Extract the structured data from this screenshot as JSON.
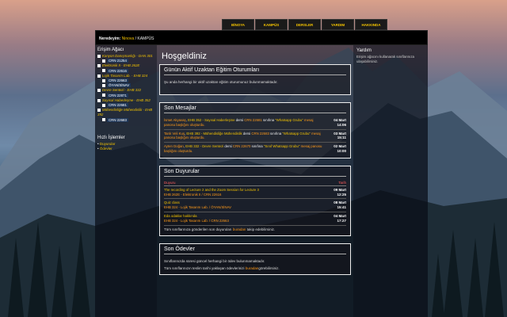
{
  "nav": {
    "tabs": [
      "BİNOYA",
      "KAMPÜS",
      "DERSLER",
      "YARDIM",
      "HAKKINDA"
    ]
  },
  "breadcrumb": {
    "label": "Neredeyim:",
    "home": "Ninova",
    "sep": " / ",
    "current": "KAMPÜS"
  },
  "left": {
    "tree_title": "Erişim Ağacı",
    "tree": [
      {
        "kind": "course",
        "text": "Kanyon Danışmanlığı - DAN 301"
      },
      {
        "kind": "crn",
        "text": "CRN 21254"
      },
      {
        "kind": "course",
        "text": "Elektronik II - EHB 262E"
      },
      {
        "kind": "crn",
        "text": "CRN 22616"
      },
      {
        "kind": "course",
        "text": "Lojik Tasarım Lab. - EHB 324"
      },
      {
        "kind": "crn",
        "text": "CRN 22663"
      },
      {
        "kind": "crn",
        "text": "ÖYAN/SİNAV"
      },
      {
        "kind": "course",
        "text": "Devre Sentezi - EHB 332"
      },
      {
        "kind": "crn",
        "text": "CRN 22871"
      },
      {
        "kind": "course",
        "text": "Sayısal Haberleşme - EHB 352"
      },
      {
        "kind": "crn",
        "text": "CRN 22681"
      },
      {
        "kind": "course",
        "text": "Mühendisliğe Mühendislik - EHB 392"
      },
      {
        "kind": "crn",
        "text": "CRN 22683"
      }
    ],
    "quick_title": "Hızlı İşlemler",
    "quick": [
      "Duyurular",
      "Ödevler"
    ]
  },
  "right": {
    "title": "Yardım",
    "text": "Erişim ağacını kullanarak sınıflarınıza ulaşabilirsiniz."
  },
  "main": {
    "title": "Hoşgeldiniz",
    "sessions": {
      "title": "Günün Aktif Uzaktan Eğitim Oturumları",
      "empty": "Şu anda herhangi bir aktif uzaktan eğitim oturumunuz bulunmamaktadır."
    },
    "messages": {
      "title": "Son Mesajlar",
      "items": [
        {
          "who": "İsmet Akyavaş",
          "c": "EHB 352 - Sayısal Haberleşme",
          "d": "dersi",
          "crn": "CRN 22681",
          "s": "sınıfına",
          "topic": "\"Whatsapp Grubu\"",
          "tail": "mesaj panosu başlığını oluşturdu.",
          "date": "04 Mart",
          "time": "14:06"
        },
        {
          "who": "Tarık Veli Kuş",
          "c": "EHB 392 - Mühendisliğe Mühendislik",
          "d": "dersi",
          "crn": "CRN 22683",
          "s": "sınıfına",
          "topic": "\"Whatsapp Grubu\"",
          "tail": "mesaj panosu başlığını oluşturdu.",
          "date": "03 Mart",
          "time": "15:11"
        },
        {
          "who": "Ayten Doğan",
          "c": "EHB 332 - Devre Sentezi",
          "d": "dersi",
          "crn": "CRN 22670",
          "s": "sınıfına",
          "topic": "\"Sınıf Whatsapp Grubu\"",
          "tail": "mesaj panosu başlığını oluşturdu.",
          "date": "02 Mart",
          "time": "10:00"
        }
      ]
    },
    "announcements": {
      "title": "Son Duyurular",
      "col_title": "Duyuru",
      "col_date": "Tarih",
      "items": [
        {
          "title": "The recording of Lecture 2 and the Zoom Session for Lecture 3",
          "sub": "EHB 262E - Elektronik II / CRN 22616",
          "date": "09 Mart",
          "time": "12:25"
        },
        {
          "title": "Quiz class",
          "sub": "EHB 324 - Lojik Tasarım Lab. / ÖYAN/SİNAV",
          "date": "08 Mart",
          "time": "15:41"
        },
        {
          "title": "Eda odaklar hakkında",
          "sub": "EHB 324 - Lojik Tasarım Lab. / CRN 22663",
          "date": "04 Mart",
          "time": "17:27"
        }
      ],
      "foot_pre": "Tüm sınıflarınıza gönderilen son duyuruları",
      "foot_link": "buradan",
      "foot_post": "takip edebilirsiniz."
    },
    "homework": {
      "title": "Son Ödevler",
      "empty": "Sınıflarınızda süresi güncel herhangi bir ödev bulunmamaktadır.",
      "foot_pre": "Tüm sınıflarınızın teslim tarihi yaklaşan ödevlerinizi",
      "foot_link": "buradan",
      "foot_post": "görebilirsiniz."
    }
  }
}
